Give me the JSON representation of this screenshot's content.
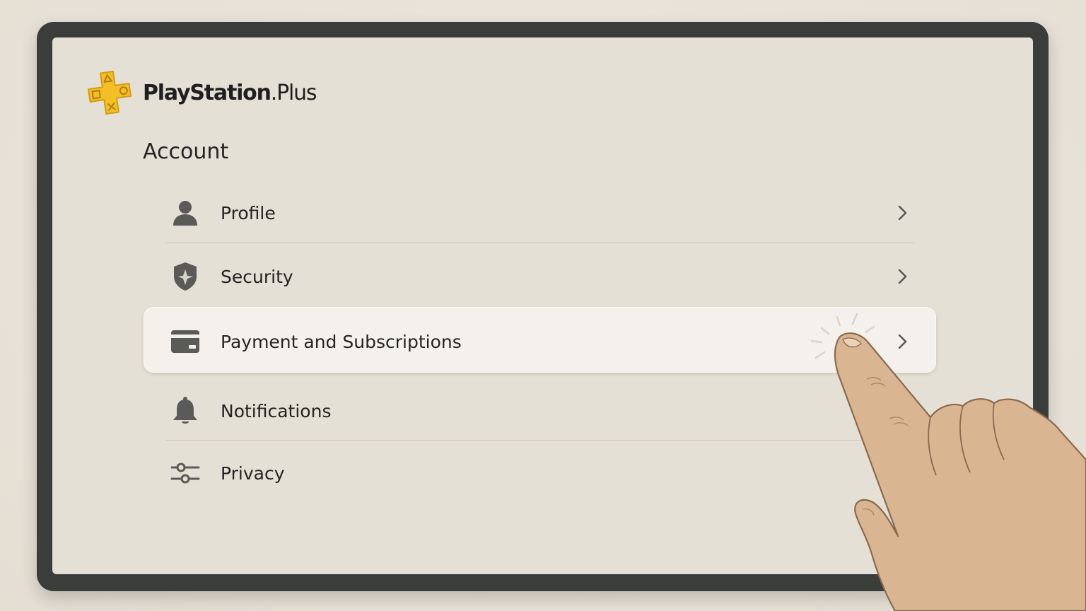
{
  "brand": {
    "name_bold": "PlayStation",
    "name_dot": ".",
    "name_light": "Plus",
    "logo_color": "#f2c025"
  },
  "section": {
    "title": "Account"
  },
  "menu": {
    "items": [
      {
        "label": "Profile",
        "icon": "person-icon",
        "selected": false
      },
      {
        "label": "Security",
        "icon": "shield-icon",
        "selected": false
      },
      {
        "label": "Payment and Subscriptions",
        "icon": "credit-card-icon",
        "selected": true
      },
      {
        "label": "Notifications",
        "icon": "bell-icon",
        "selected": false
      },
      {
        "label": "Privacy",
        "icon": "sliders-icon",
        "selected": false
      }
    ]
  },
  "colors": {
    "screen_bg": "#e5e0d5",
    "selected_bg": "#f4f1ec",
    "icon": "#5a5a58",
    "bezel": "#3b3d3a"
  }
}
